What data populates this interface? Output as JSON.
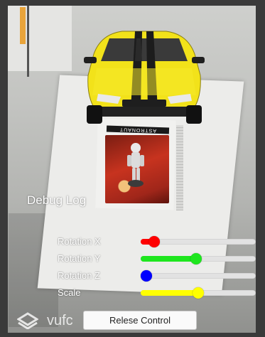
{
  "marker": {
    "card_label": "ASTRONAUT"
  },
  "debug": {
    "title": "Debug Log"
  },
  "sliders": [
    {
      "label": "Rotation X",
      "value": 0.12,
      "color": "#ff0000"
    },
    {
      "label": "Rotation Y",
      "value": 0.48,
      "color": "#1ee61e"
    },
    {
      "label": "Rotation Z",
      "value": 0.05,
      "color": "#0000ff"
    },
    {
      "label": "Scale",
      "value": 0.5,
      "color": "#ffff00"
    }
  ],
  "release_button": {
    "label": "Relese Control"
  },
  "watermark": {
    "text": "vufc"
  },
  "icons": {
    "watermark_logo": "vuforia-logo-icon"
  }
}
